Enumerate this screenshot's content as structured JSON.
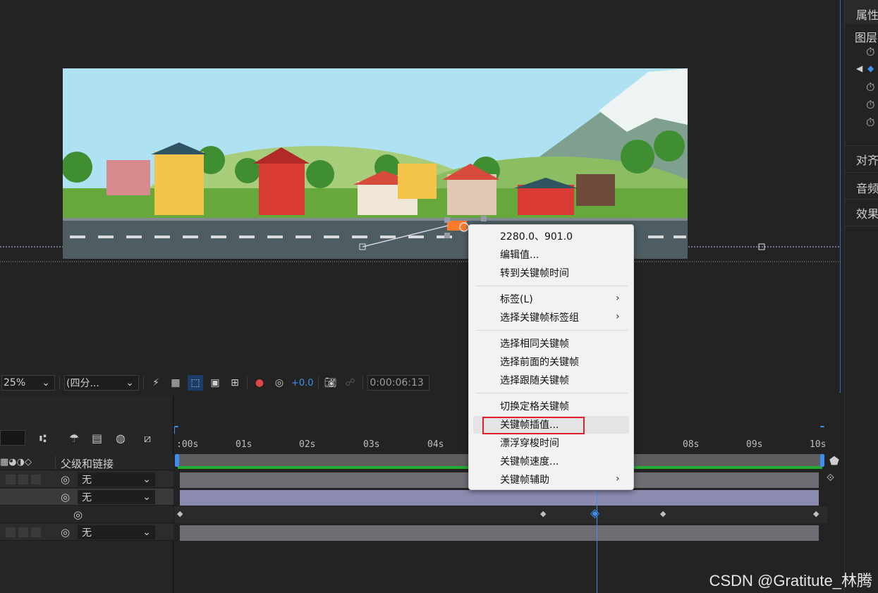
{
  "viewer": {
    "zoom": "25%",
    "resolution": "(四分...",
    "exposure": "+0.0",
    "timecode": "0:00:06:13"
  },
  "right_panel": {
    "title": "属性",
    "layer": "图层",
    "align": "对齐",
    "audio": "音频",
    "effects": "效果"
  },
  "timeline": {
    "column_header": "父级和链接",
    "rows": [
      {
        "parent": "无"
      },
      {
        "parent": "无"
      },
      {
        "parent": "无"
      }
    ],
    "ticks": [
      ":00s",
      "01s",
      "02s",
      "03s",
      "04s",
      "08s",
      "09s",
      "10s"
    ]
  },
  "context_menu": {
    "items": [
      {
        "label": "2280.0、901.0"
      },
      {
        "label": "编辑值..."
      },
      {
        "label": "转到关键帧时间"
      },
      {
        "label": "标签(L)",
        "submenu": true
      },
      {
        "label": "选择关键帧标签组",
        "submenu": true
      },
      {
        "label": "选择相同关键帧"
      },
      {
        "label": "选择前面的关键帧"
      },
      {
        "label": "选择跟随关键帧"
      },
      {
        "label": "切换定格关键帧"
      },
      {
        "label": "关键帧插值...",
        "highlighted": true
      },
      {
        "label": "漂浮穿梭时间"
      },
      {
        "label": "关键帧速度..."
      },
      {
        "label": "关键帧辅助",
        "submenu": true
      }
    ]
  },
  "watermark": "CSDN @Gratitute_林腾",
  "colors": {
    "accent": "#2e6fd6",
    "highlight_box": "#e0202a",
    "menu_bg": "#f2f2f2"
  }
}
